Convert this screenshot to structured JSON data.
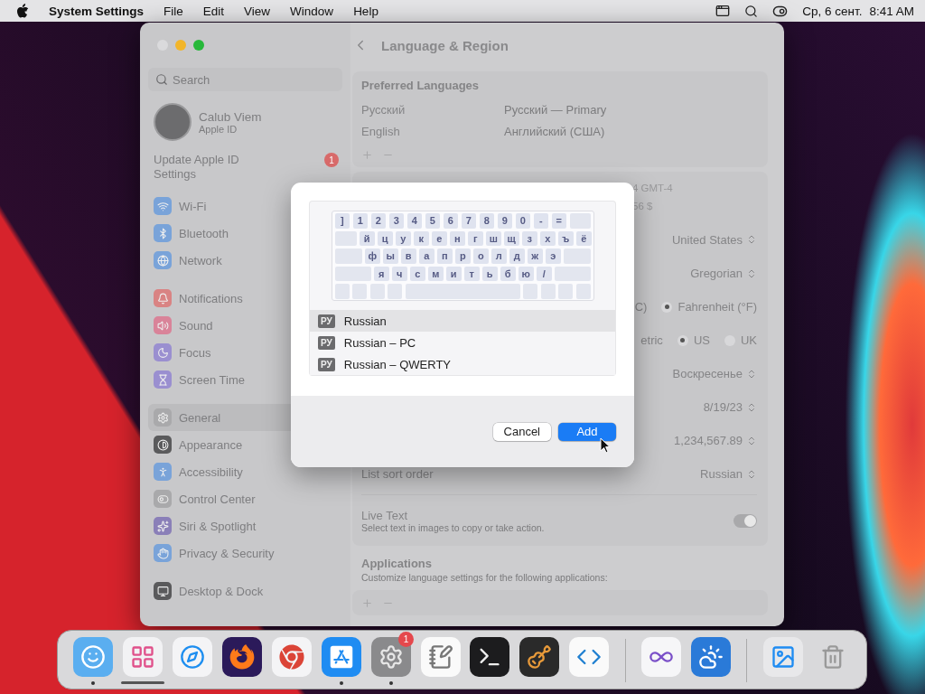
{
  "menubar": {
    "app": "System Settings",
    "menus": [
      "File",
      "Edit",
      "View",
      "Window",
      "Help"
    ],
    "date": "Ср, 6 сент.",
    "time": "8:41 AM"
  },
  "window": {
    "title": "Language & Region"
  },
  "sidebar": {
    "search": {
      "placeholder": "Search"
    },
    "account": {
      "name": "Calub Viem",
      "subtitle": "Apple ID"
    },
    "update": {
      "label": "Update Apple ID Settings",
      "badge": "1"
    },
    "groups": [
      {
        "items": [
          {
            "label": "Wi-Fi",
            "kind": "wifi",
            "color": "#79a3d9",
            "selected": false
          },
          {
            "label": "Bluetooth",
            "kind": "bluetooth",
            "color": "#79a3d9",
            "selected": false
          },
          {
            "label": "Network",
            "kind": "network",
            "color": "#79a3d9",
            "selected": false
          }
        ]
      },
      {
        "items": [
          {
            "label": "Notifications",
            "kind": "notifications",
            "color": "#d98383",
            "selected": false
          },
          {
            "label": "Sound",
            "kind": "sound",
            "color": "#d98399",
            "selected": false
          },
          {
            "label": "Focus",
            "kind": "focus",
            "color": "#9a8fd0",
            "selected": false
          },
          {
            "label": "Screen Time",
            "kind": "screentime",
            "color": "#9a8fd0",
            "selected": false
          }
        ]
      },
      {
        "items": [
          {
            "label": "General",
            "kind": "general",
            "color": "#a9a9ab",
            "selected": true
          },
          {
            "label": "Appearance",
            "kind": "appearance",
            "color": "#5a5a5c",
            "selected": false
          },
          {
            "label": "Accessibility",
            "kind": "accessibility",
            "color": "#79a3d9",
            "selected": false
          },
          {
            "label": "Control Center",
            "kind": "controlcenter",
            "color": "#a9a9ab",
            "selected": false
          },
          {
            "label": "Siri & Spotlight",
            "kind": "siri",
            "color": "#8a7fb8",
            "selected": false
          },
          {
            "label": "Privacy & Security",
            "kind": "privacy",
            "color": "#79a3d9",
            "selected": false
          }
        ]
      },
      {
        "items": [
          {
            "label": "Desktop & Dock",
            "kind": "desktop",
            "color": "#5a5a5c",
            "selected": false
          }
        ]
      }
    ]
  },
  "preferred_languages": {
    "title": "Preferred Languages",
    "languages": [
      {
        "name": "Русский",
        "detail": "Русский — Primary"
      },
      {
        "name": "English",
        "detail": "Английский (США)"
      }
    ]
  },
  "settings": [
    {
      "kind": "fragment",
      "texts": [
        "4 GMT-4",
        "56 $"
      ]
    },
    {
      "kind": "popup",
      "value": "United States"
    },
    {
      "kind": "popup",
      "value": "Gregorian"
    },
    {
      "kind": "radio",
      "prefix": "C)",
      "options": [
        {
          "label": "Fahrenheit (°F)",
          "selected": true
        }
      ]
    },
    {
      "kind": "radio",
      "prefix": "etric",
      "options": [
        {
          "label": "US",
          "selected": true
        },
        {
          "label": "UK",
          "selected": false
        }
      ]
    },
    {
      "kind": "popup",
      "value": "Воскресенье"
    },
    {
      "kind": "popup",
      "value": "8/19/23"
    },
    {
      "kind": "popup",
      "value": "1,234,567.89"
    },
    {
      "kind": "popup",
      "label": "List sort order",
      "value": "Russian"
    }
  ],
  "live_text": {
    "label": "Live Text",
    "description": "Select text in images to copy or take action.",
    "on": true
  },
  "applications": {
    "title": "Applications",
    "description": "Customize language settings for the following applications:"
  },
  "dialog": {
    "keyboard": [
      [
        "]",
        "1",
        "2",
        "3",
        "4",
        "5",
        "6",
        "7",
        "8",
        "9",
        "0",
        "-",
        "="
      ],
      [
        "й",
        "ц",
        "у",
        "к",
        "е",
        "н",
        "г",
        "ш",
        "щ",
        "з",
        "х",
        "ъ",
        "ё"
      ],
      [
        "ф",
        "ы",
        "в",
        "а",
        "п",
        "р",
        "о",
        "л",
        "д",
        "ж",
        "э"
      ],
      [
        "я",
        "ч",
        "с",
        "м",
        "и",
        "т",
        "ь",
        "б",
        "ю",
        "/"
      ]
    ],
    "layouts": [
      {
        "badge": "РУ",
        "name": "Russian",
        "selected": true
      },
      {
        "badge": "РУ",
        "name": "Russian – PC",
        "selected": false
      },
      {
        "badge": "РУ",
        "name": "Russian – QWERTY",
        "selected": false
      }
    ],
    "buttons": [
      {
        "label": "Cancel",
        "kind": "secondary"
      },
      {
        "label": "Add",
        "kind": "primary"
      }
    ]
  },
  "dock": {
    "sections": [
      [
        {
          "kind": "finder",
          "running": true
        },
        {
          "kind": "launchpad",
          "downloading": true
        },
        {
          "kind": "safari"
        },
        {
          "kind": "firefox"
        },
        {
          "kind": "chrome"
        },
        {
          "kind": "appstore",
          "running": true
        },
        {
          "kind": "settings",
          "running": true,
          "badge": "1"
        },
        {
          "kind": "textedit"
        },
        {
          "kind": "terminal"
        },
        {
          "kind": "garageband"
        },
        {
          "kind": "vscode"
        }
      ],
      [
        {
          "kind": "visualstudio"
        },
        {
          "kind": "weather"
        }
      ],
      [
        {
          "kind": "screenshot"
        },
        {
          "kind": "trash"
        }
      ]
    ]
  }
}
